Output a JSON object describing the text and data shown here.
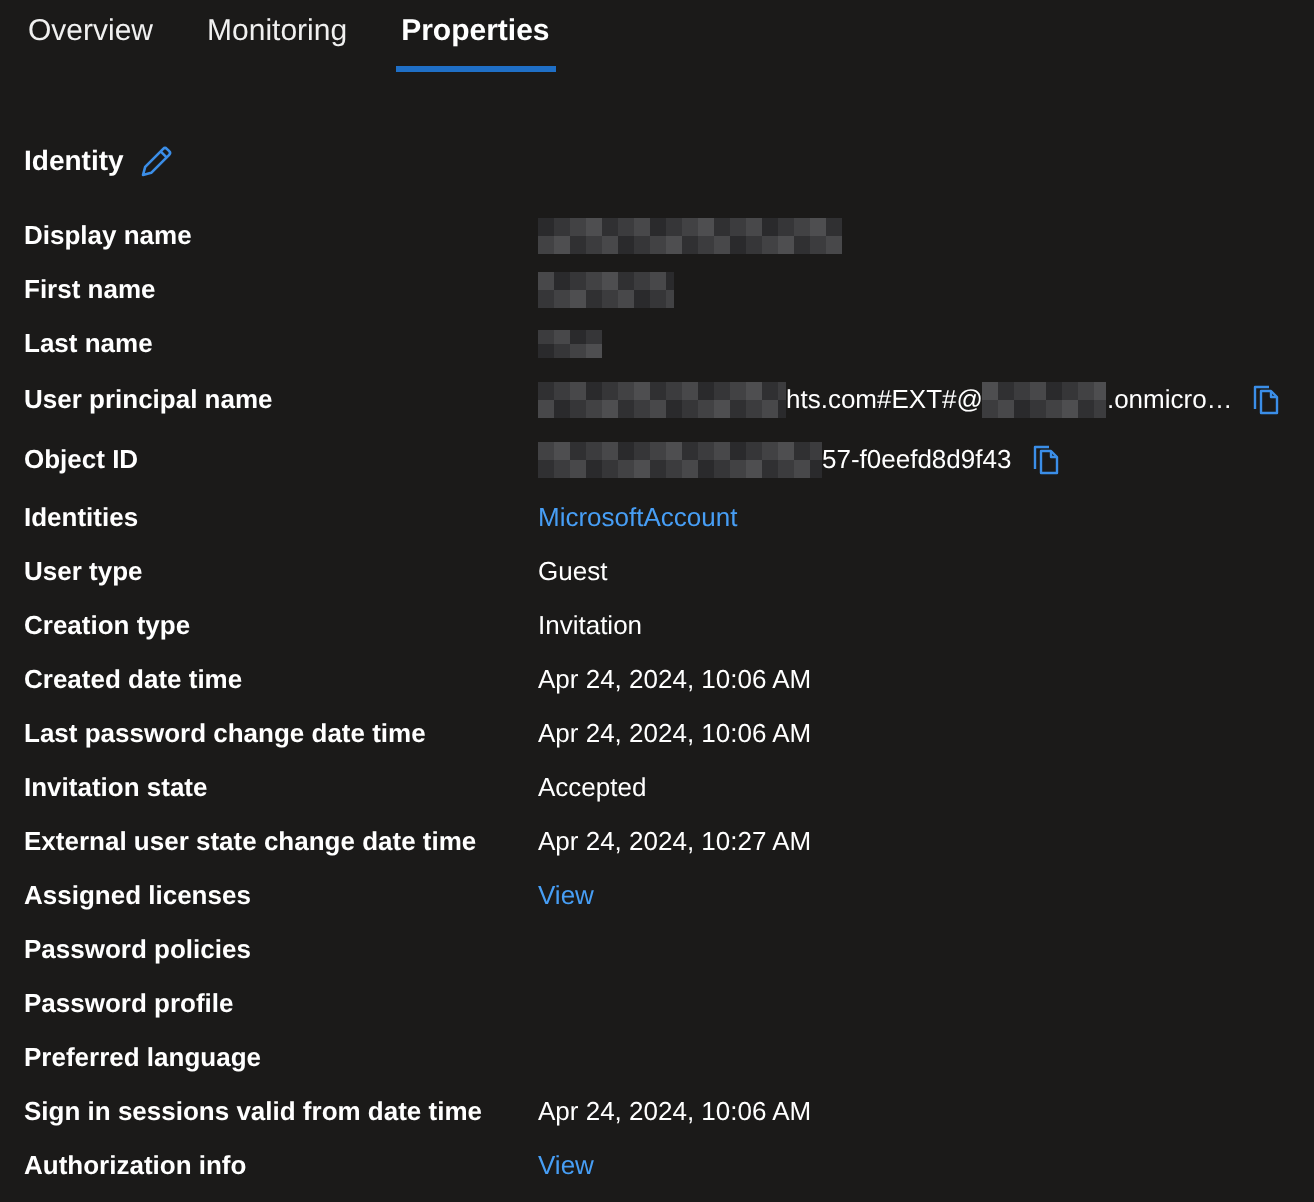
{
  "tabs": [
    {
      "label": "Overview",
      "selected": false
    },
    {
      "label": "Monitoring",
      "selected": false
    },
    {
      "label": "Properties",
      "selected": true
    }
  ],
  "section": {
    "title": "Identity"
  },
  "properties": [
    {
      "label": "Display name",
      "value": [
        {
          "kind": "redacted"
        }
      ]
    },
    {
      "label": "First name",
      "value": [
        {
          "kind": "redacted"
        }
      ]
    },
    {
      "label": "Last name",
      "value": [
        {
          "kind": "redacted"
        }
      ]
    },
    {
      "label": "User principal name",
      "value": [
        {
          "kind": "redacted"
        },
        {
          "kind": "text",
          "text": "hts.com#EXT#@"
        },
        {
          "kind": "redacted"
        },
        {
          "kind": "text",
          "text": ".onmicro…"
        }
      ],
      "copy": true
    },
    {
      "label": "Object ID",
      "value": [
        {
          "kind": "redacted"
        },
        {
          "kind": "text",
          "text": "57-f0eefd8d9f43"
        }
      ],
      "copy": true
    },
    {
      "label": "Identities",
      "value": [
        {
          "kind": "link",
          "text": "MicrosoftAccount"
        }
      ]
    },
    {
      "label": "User type",
      "value": [
        {
          "kind": "text",
          "text": "Guest"
        }
      ]
    },
    {
      "label": "Creation type",
      "value": [
        {
          "kind": "text",
          "text": "Invitation"
        }
      ]
    },
    {
      "label": "Created date time",
      "value": [
        {
          "kind": "text",
          "text": "Apr 24, 2024, 10:06 AM"
        }
      ]
    },
    {
      "label": "Last password change date time",
      "value": [
        {
          "kind": "text",
          "text": "Apr 24, 2024, 10:06 AM"
        }
      ]
    },
    {
      "label": "Invitation state",
      "value": [
        {
          "kind": "text",
          "text": "Accepted"
        }
      ]
    },
    {
      "label": "External user state change date time",
      "value": [
        {
          "kind": "text",
          "text": "Apr 24, 2024, 10:27 AM"
        }
      ]
    },
    {
      "label": "Assigned licenses",
      "value": [
        {
          "kind": "link",
          "text": "View"
        }
      ]
    },
    {
      "label": "Password policies"
    },
    {
      "label": "Password profile"
    },
    {
      "label": "Preferred language"
    },
    {
      "label": "Sign in sessions valid from date time",
      "value": [
        {
          "kind": "text",
          "text": "Apr 24, 2024, 10:06 AM"
        }
      ]
    },
    {
      "label": "Authorization info",
      "value": [
        {
          "kind": "link",
          "text": "View"
        }
      ]
    }
  ]
}
